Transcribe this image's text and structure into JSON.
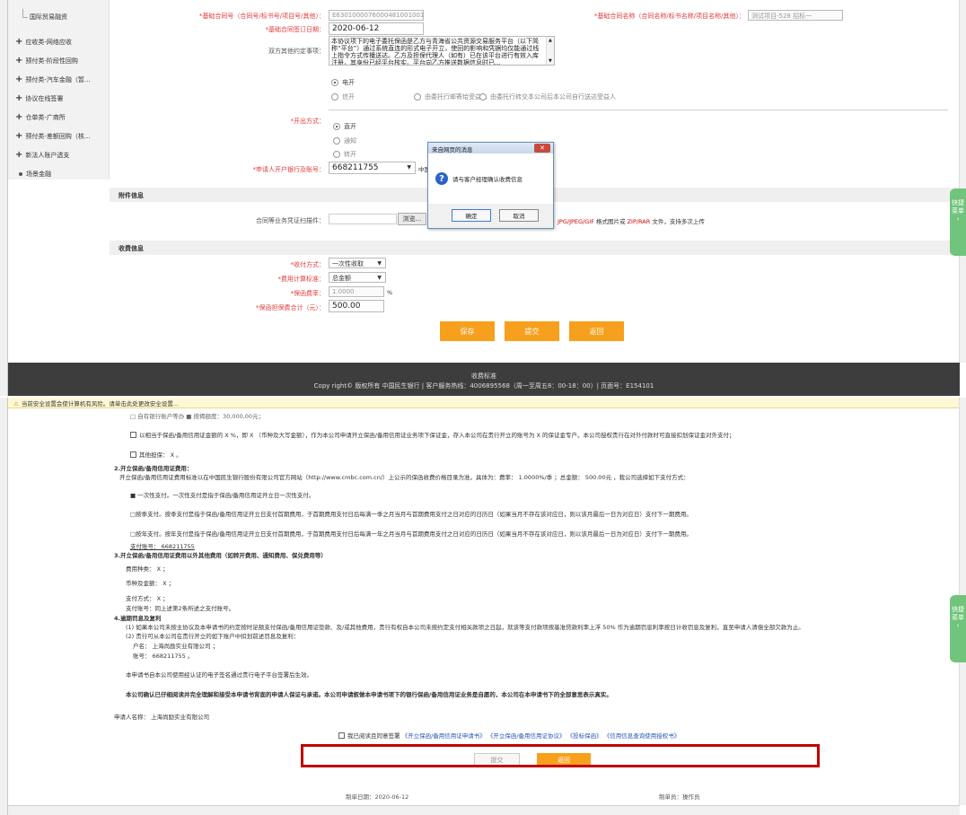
{
  "sidebar": {
    "items": [
      {
        "label": "国际贸易融资",
        "kind": "sub"
      },
      {
        "label": "应收类-网络应收",
        "kind": "group"
      },
      {
        "label": "预付类-阶段性回购",
        "kind": "group"
      },
      {
        "label": "预付类-汽车金融（暂...",
        "kind": "group"
      },
      {
        "label": "协议在线签署",
        "kind": "group"
      },
      {
        "label": "仓单类-广商所",
        "kind": "group"
      },
      {
        "label": "预付类-差额回购（核...",
        "kind": "group"
      },
      {
        "label": "新法人账户透支",
        "kind": "group"
      },
      {
        "label": "场景金融",
        "kind": "dot"
      }
    ]
  },
  "form": {
    "contract_no_label": "*基础合同号（合同号/标书号/项目号/其他）：",
    "contract_no_value": "E63010000760004810010​01",
    "contract_name_label": "*基础合同名称（合同名称/标书名称/项目名称/其他）：",
    "contract_name_value": "测试项目-528 招标一",
    "sign_date_label": "*基础合同签订日期：",
    "sign_date_value": "2020-06-12",
    "both_parties_label": "双方其他约定事项：",
    "both_parties_text": "本协议项下的电子委托保函是乙方与青海省公共资源交易服务平台（以下简称“平台”）通过系统直连的形式电子开立，使回的影响和凭据均仅能通过线上指令方式传播送达。乙方及担保代理人（如有）已在该平台进行有效入库注册，其身份已经平台核实。平台向乙方推送数据信息时已...",
    "delivery_options": [
      "电开",
      "信开"
    ],
    "delivery_sub_options": [
      "由委托行邮寄给受益人",
      "由委托行转交本公司后本公司自行送达受益人"
    ],
    "open_method_label": "*开出方式：",
    "open_method_options": [
      "直开",
      "通知",
      "转开"
    ],
    "account_label": "*申请人开户银行及账号：",
    "account_value": "668211755",
    "account_trail": "中国",
    "attach_section": "附件信息",
    "attach_label": "合同等业务凭证扫描件：",
    "browse_label": "浏览...",
    "attach_hint_prefix": "JPG/JPEG/GIF",
    "attach_hint_mid": " 格式图片或 ",
    "attach_hint_zip": "ZIP/RAR",
    "attach_hint_suffix": " 文件，支持多次上传",
    "fee_section": "收费信息",
    "pay_method_label": "*收付方式：",
    "pay_method_value": "一次性收取",
    "fee_std_label": "*费用计算标准：",
    "fee_std_value": "总金额",
    "rate_label": "*保函费率：",
    "rate_value": "1.0000",
    "rate_unit": "%",
    "total_label": "*保函担保费合计（元）：",
    "total_value": "500.00",
    "btn_save": "保存",
    "btn_submit": "提交",
    "btn_back": "返回"
  },
  "dialog": {
    "title": "来自网页的消息",
    "close": "✕",
    "message": "请与客户经理确认收费信息",
    "ok": "确定",
    "cancel": "取消"
  },
  "footer": {
    "line1": "收费标准",
    "line2": "Copy right© 版权所有 中国民生银行 | 客户服务热线：4006895568（周一至周五8：00-18：00）| 页面号：E154101"
  },
  "side_tab": "快捷菜单",
  "bottom": {
    "warn": "当前安全设置会使计算机有风险。请单击此处更改安全设置...",
    "r0": "□ 自有银行账户等办 ■ 按揭额度：30,000,00元；",
    "r1": "以相当于保函/备用信用证金额的  X  %，即  X （币种及大写金额），作为本公司申请开立保函/备用信用证业务项下保证金，存入本公司在贵行开立的账号为  X  的保证金专户。本公司授权贵行在对外付款时可直接扣划保证金对外支付；",
    "r2": "其他担保：  X  。",
    "r3": "2.开立保函/备用信用证费用：",
    "r4": "开立保函/备用信用证费用标准以在中国民生银行股份有限公司官方网站（http://www.cmbc.com.cn/）上公示的保函收费价格目录为准。具体为：费率：  1.0000%/季  ；总金额：  500.00元  ，我公司选择如下支付方式：",
    "r5": "■ 一次性支付。一次性支付是指于保函/备用信用证开立日一次性支付。",
    "r6": "□按季支付。按季支付是指于保函/备用信用证开立日支付首期费用，于首期费用支付日后每满一季之月当月与首期费用支付之日对应的日历日（如果当月不存在该对应日，则以该月最后一日为对应日）支付下一期费用。",
    "r7": "□按年支付。按年支付是指于保函/备用信用证开立日支付首期费用，于首期费用支付日后每满一年之月当月与首期费用支付之日对应的日历日（如果当月不存在该对应日，则以该月最后一日为对应日）支付下一期费用。",
    "r8": "支付账号：  668211755",
    "r9": "3.开立保函/备用信用证费用以外其他费用（如转开费用、通知费用、保兑费用等）",
    "r10": "费用种类：  X  ；",
    "r11": "币种及金额：  X  ；",
    "r12": "支付方式：  X  ；",
    "r13": "支付账号：同上述第2条所述之支付账号。",
    "r14": "4.逾期罚息及复利",
    "r15": "(1) 如果本公司未按主协议及本申请书的约定按时足额支付保函/备用信用证垫款、及/或其他费用，贵行有权自本公司未按约定支付相关款项之日起，就该等支付款项按基准贷款利率上浮  50%  作为逾期罚息利率按日计收罚息及复利，直至申请人清偿全部欠款为止。",
    "r16": "(2) 贵行可从本公司在贵行开立的如下账户中扣划前述罚息及复利：",
    "r17": "户名：  上海尚励实业有限公司  ；",
    "r18": "账号：  668211755  。",
    "r19": "本申请书自本公司使用经认证的电子签名通过贵行电子平台签署后生效。",
    "r20": "本公司确认已仔细阅读并完全理解和接受本申请书背面的申请人保证与承诺。本公司申请叙做本申请书项下的银行保函/备用信用证业务是自愿的，本公司在本申请书下的全部意思表示真实。",
    "r21": "申请人名称：  上海尚励实业有限公司",
    "agree_prefix": "我已阅读且同意签署",
    "agree_docs": [
      "《开立保函/备用信用证申请书》",
      "《开立保函/备用信用证协议》",
      "《投标保函》",
      "《信用信息查询使用授权书》"
    ],
    "btn_submit": "提交",
    "btn_back": "返回",
    "made_date": "制单日期：2020-06-12",
    "made_by": "制单员：操作员"
  }
}
